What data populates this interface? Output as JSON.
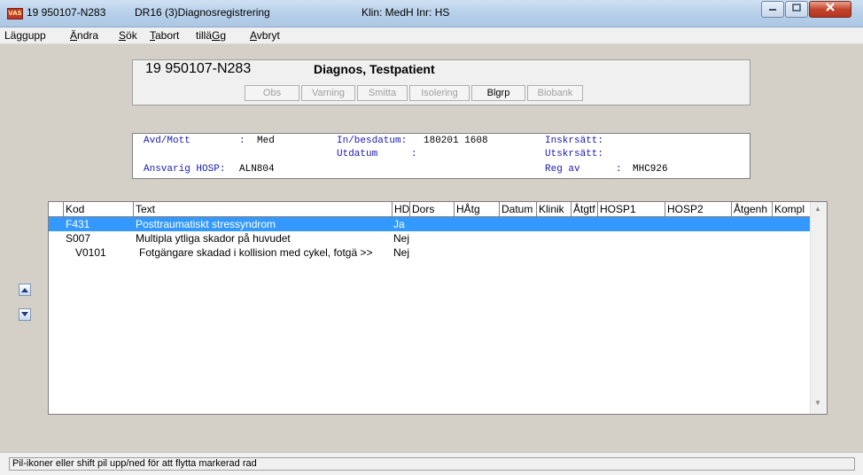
{
  "window": {
    "app_icon": "VAS",
    "title_patient": "19 950107-N283",
    "title_module": "DR16 (3)Diagnosregistrering",
    "title_clinic": "Klin: MedH  Inr: HS",
    "minimize_icon": "minimize-icon",
    "maximize_icon": "maximize-icon",
    "close_icon": "close-icon"
  },
  "menu": [
    {
      "prefix": "",
      "accel": "",
      "rest": "Läggupp"
    },
    {
      "prefix": "",
      "accel": "Ä",
      "rest": "ndra"
    },
    {
      "prefix": "",
      "accel": "S",
      "rest": "ök"
    },
    {
      "prefix": "",
      "accel": "T",
      "rest": "abort"
    },
    {
      "prefix": "tillä",
      "accel": "G",
      "rest": "g"
    },
    {
      "prefix": "",
      "accel": "A",
      "rest": "vbryt"
    }
  ],
  "patient": {
    "id": "19 950107-N283",
    "name": "Diagnos, Testpatient",
    "flags": [
      {
        "label": "Obs",
        "active": false
      },
      {
        "label": "Varning",
        "active": false
      },
      {
        "label": "Smitta",
        "active": false
      },
      {
        "label": "Isolering",
        "active": false
      },
      {
        "label": "Blgrp",
        "active": true
      },
      {
        "label": "Biobank",
        "active": false
      }
    ]
  },
  "info": {
    "avd_label": "Avd/Mott",
    "avd_sep": ": ",
    "avd_value": "Med",
    "ansvarig_label": "Ansvarig HOSP:",
    "ansvarig_value": "ALN804",
    "inbes_label": "In/besdatum:",
    "inbes_value": "180201 1608",
    "utdatum_label": "Utdatum",
    "utdatum_sep": ":",
    "inskr_label": "Inskrsätt:",
    "utskr_label": "Utskrsätt:",
    "regav_label": "Reg av",
    "regav_sep": ":",
    "regav_value": "MHC926"
  },
  "grid": {
    "columns": [
      "Kod",
      "Text",
      "HD",
      "Dors",
      "HÅtg",
      "Datum",
      "Klinik",
      "Åtgtf",
      "HOSP1",
      "HOSP2",
      "Åtgenh",
      "Kompl"
    ],
    "rows": [
      {
        "kod": "F431",
        "text": "Posttraumatiskt stressyndrom",
        "hd": "Ja",
        "selected": true
      },
      {
        "kod": "S007",
        "text": "Multipla ytliga skador på huvudet",
        "hd": "Nej",
        "selected": false
      },
      {
        "kod": "V0101",
        "text": "Fotgängare skadad i kollision med cykel, fotgä >>",
        "hd": "Nej",
        "selected": false
      }
    ]
  },
  "move_buttons": {
    "up_icon": "arrow-up-icon",
    "down_icon": "arrow-down-icon"
  },
  "status": {
    "text": "Pil-ikoner eller shift pil upp/ned för att flytta markerad rad"
  }
}
